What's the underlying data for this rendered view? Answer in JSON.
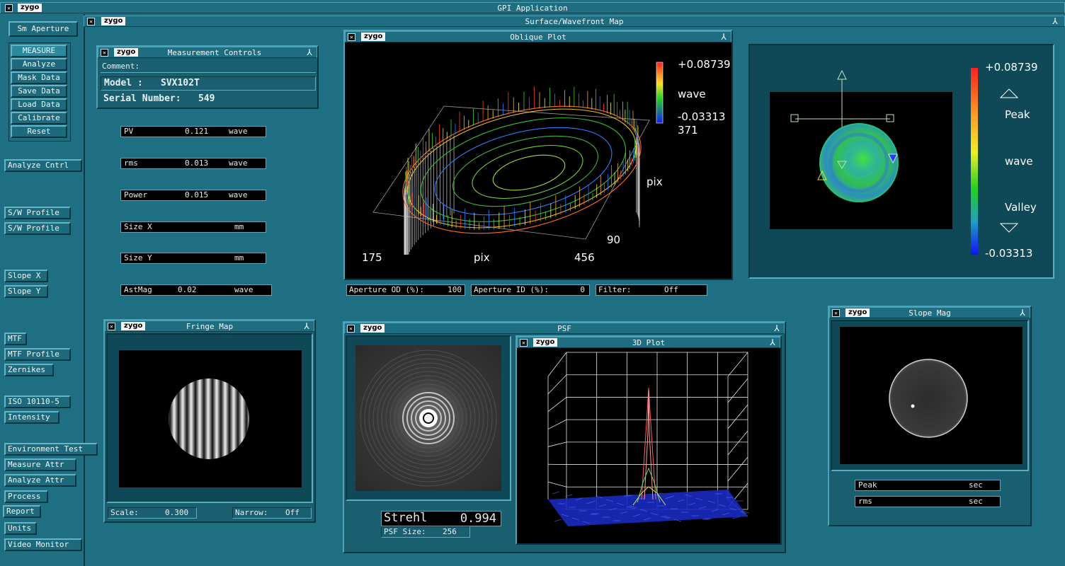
{
  "app": {
    "title": "GPI Application",
    "logo": "zygo"
  },
  "sidebar": {
    "aperture_button": "Sm Aperture",
    "main_buttons": [
      "MEASURE",
      "Analyze",
      "Mask Data",
      "Save Data",
      "Load Data",
      "Calibrate",
      "Reset"
    ],
    "analyze_cntrl": "Analyze Cntrl",
    "profiles": [
      "S/W Profile",
      "S/W Profile"
    ],
    "slopes": [
      "Slope X",
      "Slope Y"
    ],
    "mtf": [
      "MTF",
      "MTF Profile",
      "Zernikes"
    ],
    "iso": [
      "ISO 10110-5",
      "Intensity"
    ],
    "misc": [
      "Environment Test",
      "Measure Attr",
      "Analyze Attr",
      "Process",
      "Report",
      "Units",
      "Video Monitor"
    ]
  },
  "surface_window": {
    "title": "Surface/Wavefront Map"
  },
  "measurement_controls": {
    "title": "Measurement Controls",
    "comment_label": "Comment:",
    "model_label": "Model :",
    "model_value": "SVX102T",
    "serial_label": "Serial Number:",
    "serial_value": "549"
  },
  "results": [
    {
      "name": "PV",
      "value": "0.121",
      "unit": "wave"
    },
    {
      "name": "rms",
      "value": "0.013",
      "unit": "wave"
    },
    {
      "name": "Power",
      "value": "0.015",
      "unit": "wave"
    },
    {
      "name": "Size X",
      "value": "",
      "unit": "mm"
    },
    {
      "name": "Size Y",
      "value": "",
      "unit": "mm"
    },
    {
      "name": "AstMag",
      "value": "0.02",
      "unit": "wave"
    }
  ],
  "oblique_plot": {
    "title": "Oblique Plot",
    "scale_max": "+0.08739",
    "scale_unit": "wave",
    "scale_min": "-0.03313",
    "y_top": "371",
    "y_unit": "pix",
    "y_bottom": "90",
    "x_left": "175",
    "x_unit": "pix",
    "x_right": "456"
  },
  "aperture_fields": {
    "od_label": "Aperture OD (%):",
    "od_value": "100",
    "id_label": "Aperture ID (%):",
    "id_value": "0",
    "filter_label": "Filter:",
    "filter_value": "Off"
  },
  "color_map": {
    "scale_max": "+0.08739",
    "peak_label": "Peak",
    "unit": "wave",
    "valley_label": "Valley",
    "scale_min": "-0.03313"
  },
  "fringe_map": {
    "title": "Fringe Map",
    "scale_label": "Scale:",
    "scale_value": "0.300",
    "narrow_label": "Narrow:",
    "narrow_value": "Off"
  },
  "psf": {
    "title": "PSF",
    "strehl_label": "Strehl",
    "strehl_value": "0.994",
    "size_label": "PSF Size:",
    "size_value": "256"
  },
  "plot3d": {
    "title": "3D Plot"
  },
  "slope_mag": {
    "title": "Slope Mag",
    "fields": [
      {
        "name": "Peak",
        "value": "",
        "unit": "sec"
      },
      {
        "name": "rms",
        "value": "",
        "unit": "sec"
      }
    ]
  },
  "colors": {
    "background": "#1f6f82",
    "panel": "#1a5f70"
  }
}
